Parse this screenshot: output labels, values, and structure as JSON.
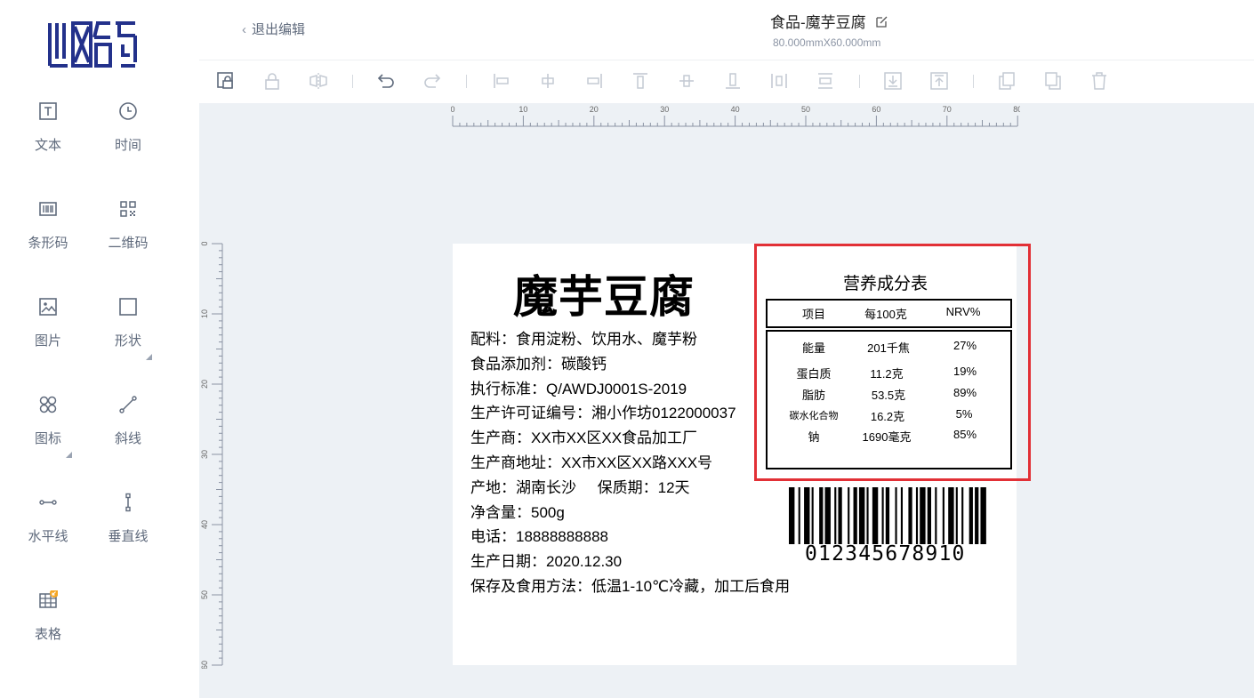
{
  "header": {
    "back_label": "退出编辑",
    "doc_title": "食品-魔芋豆腐",
    "doc_size": "80.000mmX60.000mm"
  },
  "sidebar": {
    "tools": [
      {
        "label": "文本",
        "icon": "text-icon"
      },
      {
        "label": "时间",
        "icon": "clock-icon"
      },
      {
        "label": "条形码",
        "icon": "barcode-icon"
      },
      {
        "label": "二维码",
        "icon": "qrcode-icon"
      },
      {
        "label": "图片",
        "icon": "image-icon"
      },
      {
        "label": "形状",
        "icon": "rectangle-shape-icon"
      },
      {
        "label": "图标",
        "icon": "icon-grid-icon"
      },
      {
        "label": "斜线",
        "icon": "diagonal-line-icon"
      },
      {
        "label": "水平线",
        "icon": "horizontal-line-icon"
      },
      {
        "label": "垂直线",
        "icon": "vertical-line-icon"
      },
      {
        "label": "表格",
        "icon": "table-icon"
      }
    ]
  },
  "toolbar": {
    "buttons": [
      "lock-select-icon",
      "lock-icon",
      "flip-icon",
      "undo-icon",
      "redo-icon",
      "align-left-icon",
      "align-center-h-icon",
      "align-right-icon",
      "align-top-icon",
      "align-middle-v-icon",
      "align-bottom-icon",
      "distribute-h-icon",
      "distribute-v-icon",
      "move-down-layer-icon",
      "move-up-layer-icon",
      "copy-icon",
      "paste-icon",
      "delete-icon"
    ]
  },
  "rulers": {
    "h_ticks": [
      "0",
      "10",
      "20",
      "30",
      "40",
      "50",
      "60",
      "70",
      "80"
    ],
    "v_ticks": [
      "0",
      "10",
      "20",
      "30",
      "40",
      "50",
      "60"
    ]
  },
  "label": {
    "product_name": "魔芋豆腐",
    "lines": [
      "配料：食用淀粉、饮用水、魔芋粉",
      "食品添加剂：碳酸钙",
      "执行标准：Q/AWDJ0001S-2019",
      "生产许可证编号：湘小作坊0122000037",
      "生产商：XX市XX区XX食品加工厂",
      "生产商地址：XX市XX区XX路XXX号",
      "产地：湖南长沙     保质期：12天",
      "净含量：500g",
      "电话：18888888888",
      "生产日期：2020.12.30",
      "保存及食用方法：低温1-10℃冷藏，加工后食用"
    ],
    "nutrition": {
      "title": "营养成分表",
      "headers": [
        "项目",
        "每100克",
        "NRV%"
      ],
      "rows": [
        [
          "能量",
          "201千焦",
          "27%"
        ],
        [
          "蛋白质",
          "11.2克",
          "19%"
        ],
        [
          "脂肪",
          "53.5克",
          "89%"
        ],
        [
          "碳水化合物",
          "16.2克",
          "5%"
        ],
        [
          "钠",
          "1690毫克",
          "85%"
        ]
      ]
    },
    "barcode_digits": "012345678910"
  },
  "colors": {
    "logo": "#23318b",
    "selection": "#e23036",
    "canvas_bg": "#edf1f5",
    "icon_gray": "#5f6a7c",
    "badge": "#f5a623"
  }
}
